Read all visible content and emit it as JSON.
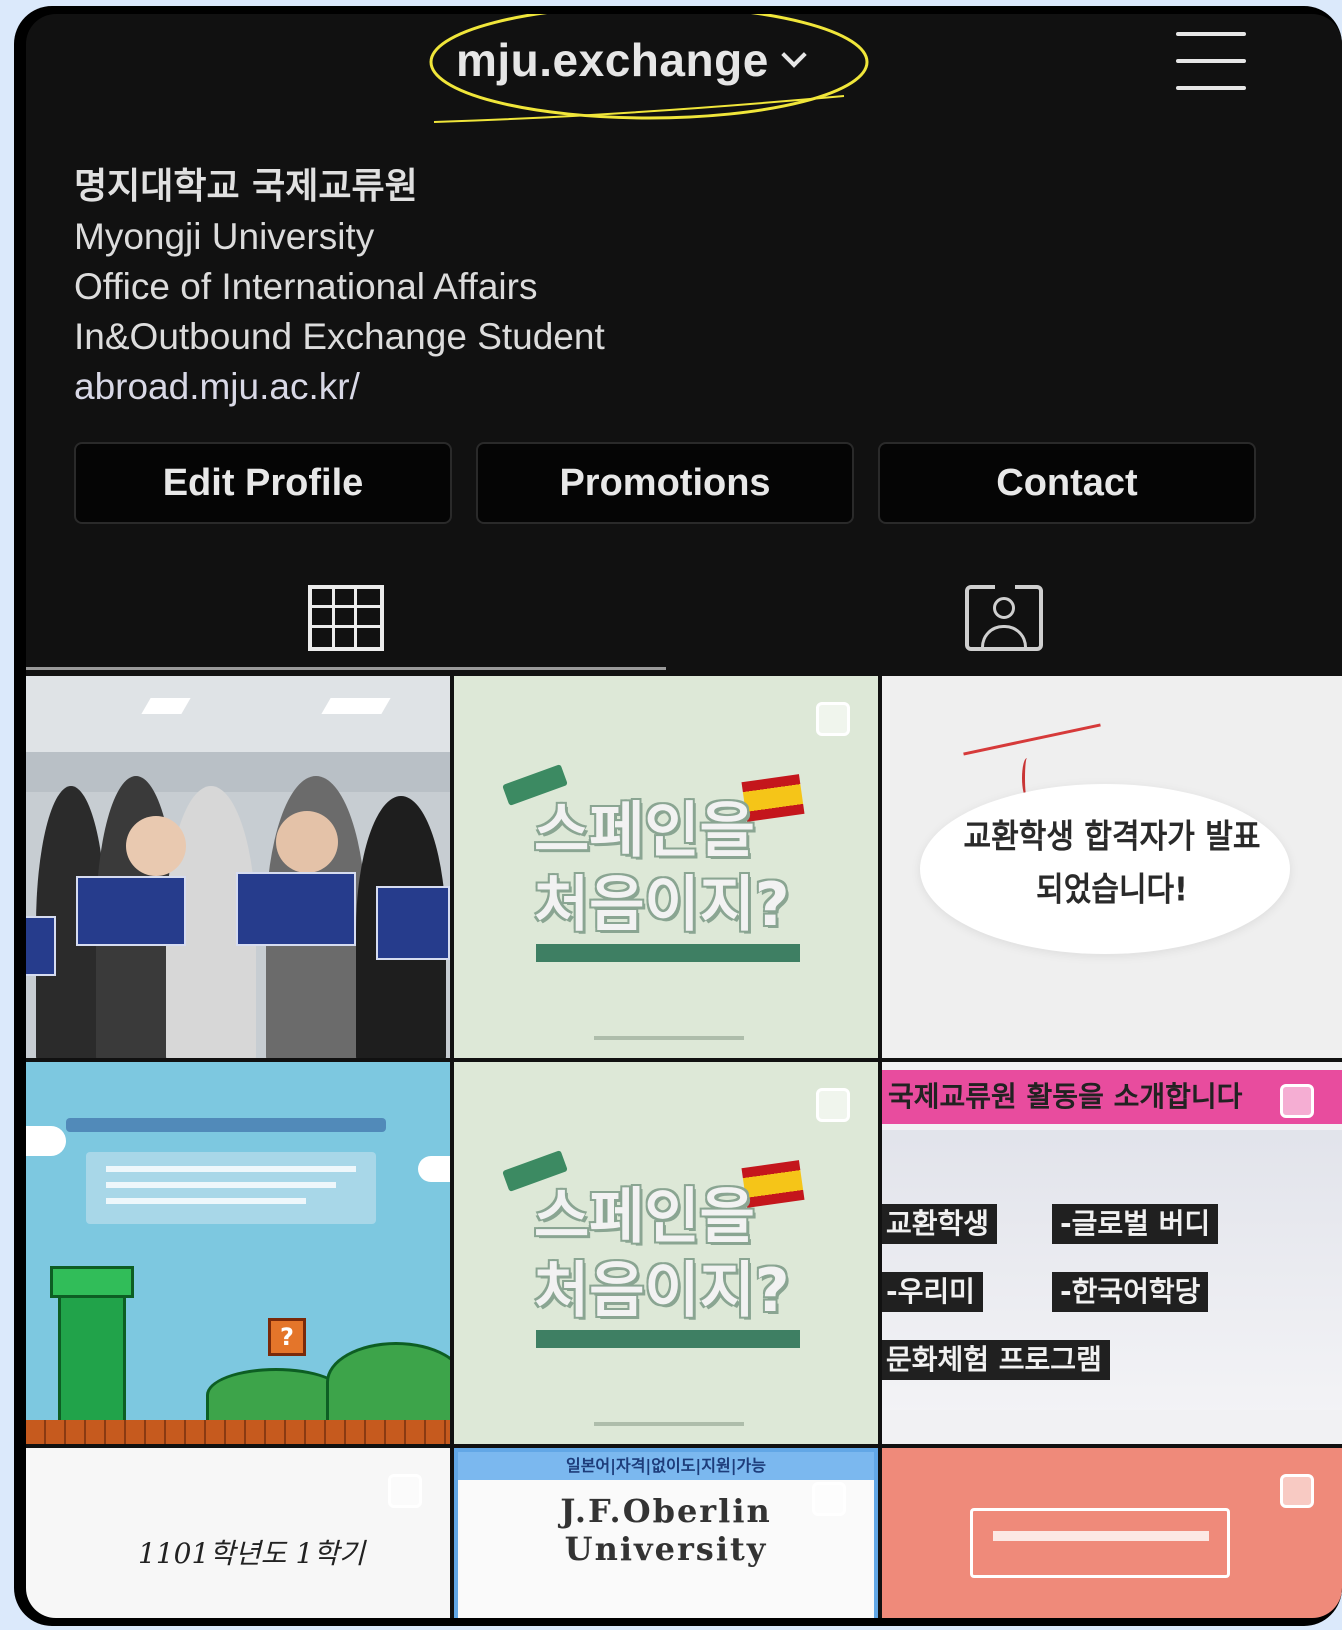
{
  "header": {
    "username": "mju.exchange"
  },
  "bio": {
    "name": "명지대학교 국제교류원",
    "lines": [
      "Myongji University",
      "Office of International Affairs",
      "In&Outbound Exchange Student"
    ],
    "link": "abroad.mju.ac.kr/"
  },
  "buttons": {
    "edit_profile": "Edit Profile",
    "promotions": "Promotions",
    "contact": "Contact"
  },
  "posts": {
    "spain_title": "스페인을\n처음이지?",
    "notice_text": "교환학생 합격자가 발표 되었습니다!",
    "pink_header": "국제교류원 활동을 소개합니다",
    "pink_labels": [
      "교환학생",
      "-글로벌 버디",
      "-우리미",
      "-한국어학당",
      "문화체험 프로그램"
    ],
    "white_post_text": "1101학년도 1학기",
    "oberlin_bar": "일본어|자격|없이도|지원|가능",
    "oberlin_text": "J.F.Oberlin\nUniversity"
  },
  "colors": {
    "background": "#dbe9fb",
    "screen": "#111111",
    "highlight": "#f0e63a"
  },
  "icons": {
    "menu": "hamburger-menu-icon",
    "grid": "grid-icon",
    "tagged": "tagged-person-icon",
    "dropdown": "chevron-down-icon"
  }
}
